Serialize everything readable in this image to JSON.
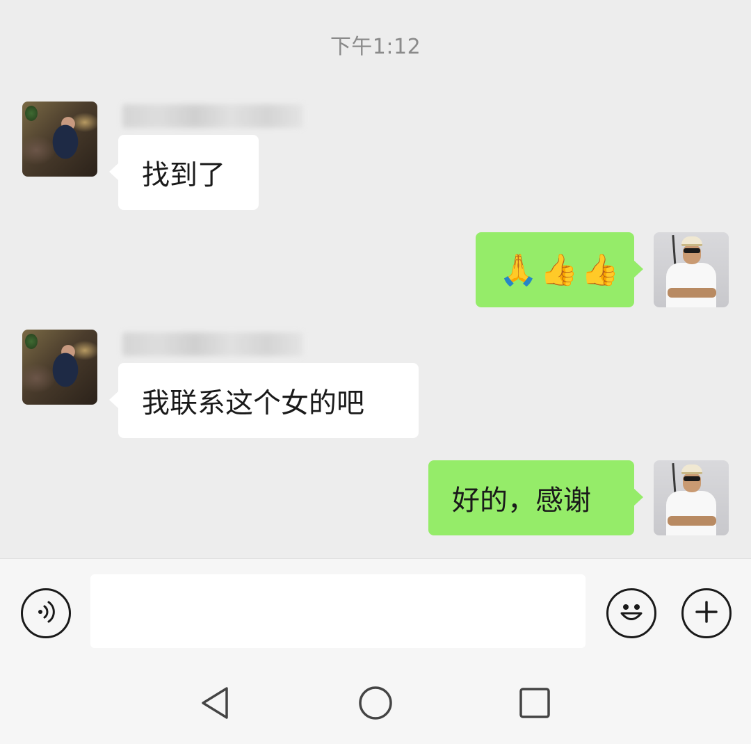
{
  "chat": {
    "timestamp": "下午1:12",
    "messages": [
      {
        "direction": "incoming",
        "text": "找到了"
      },
      {
        "direction": "outgoing",
        "text": "🙏👍👍"
      },
      {
        "direction": "incoming",
        "text": "我联系这个女的吧"
      },
      {
        "direction": "outgoing",
        "text": "好的，感谢"
      }
    ]
  },
  "input_bar": {
    "voice_icon": "voice-icon",
    "emoji_icon": "emoji-icon",
    "plus_icon": "plus-icon",
    "text_value": "",
    "placeholder": ""
  },
  "nav_bar": {
    "icons": [
      "back-icon",
      "home-icon",
      "recent-apps-icon"
    ]
  },
  "colors": {
    "background": "#ededed",
    "incoming_bubble": "#ffffff",
    "outgoing_bubble": "#95ec69",
    "timestamp": "#8a8a8a"
  }
}
